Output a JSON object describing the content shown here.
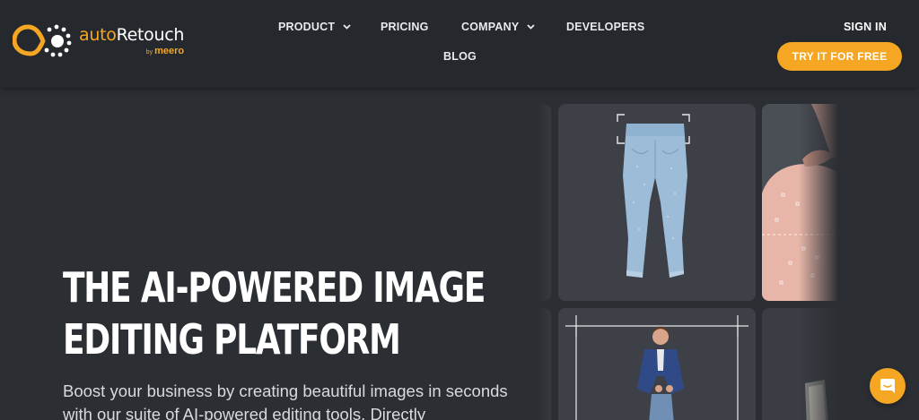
{
  "brand": {
    "name_part1": "auto",
    "name_part2": "Retouch",
    "by_prefix": "by",
    "by_name": "meero",
    "accent_color": "#f5a623"
  },
  "nav": {
    "items": [
      {
        "label": "PRODUCT",
        "has_dropdown": true
      },
      {
        "label": "PRICING",
        "has_dropdown": false
      },
      {
        "label": "COMPANY",
        "has_dropdown": true
      },
      {
        "label": "DEVELOPERS",
        "has_dropdown": false
      },
      {
        "label": "BLOG",
        "has_dropdown": false
      }
    ],
    "sign_in": "SIGN IN",
    "cta": "TRY IT FOR FREE"
  },
  "hero": {
    "title_line1": "THE AI-POWERED IMAGE",
    "title_line2": "EDITING PLATFORM",
    "subtitle": "Boost your business by creating beautiful images in seconds with our suite of AI-powered editing tools. Directly"
  },
  "icons": {
    "dropdown": "chevron-down-icon",
    "chat": "chat-bubble-icon"
  },
  "colors": {
    "background": "#2b2e33",
    "header": "#25282d",
    "card": "#3d4147"
  }
}
